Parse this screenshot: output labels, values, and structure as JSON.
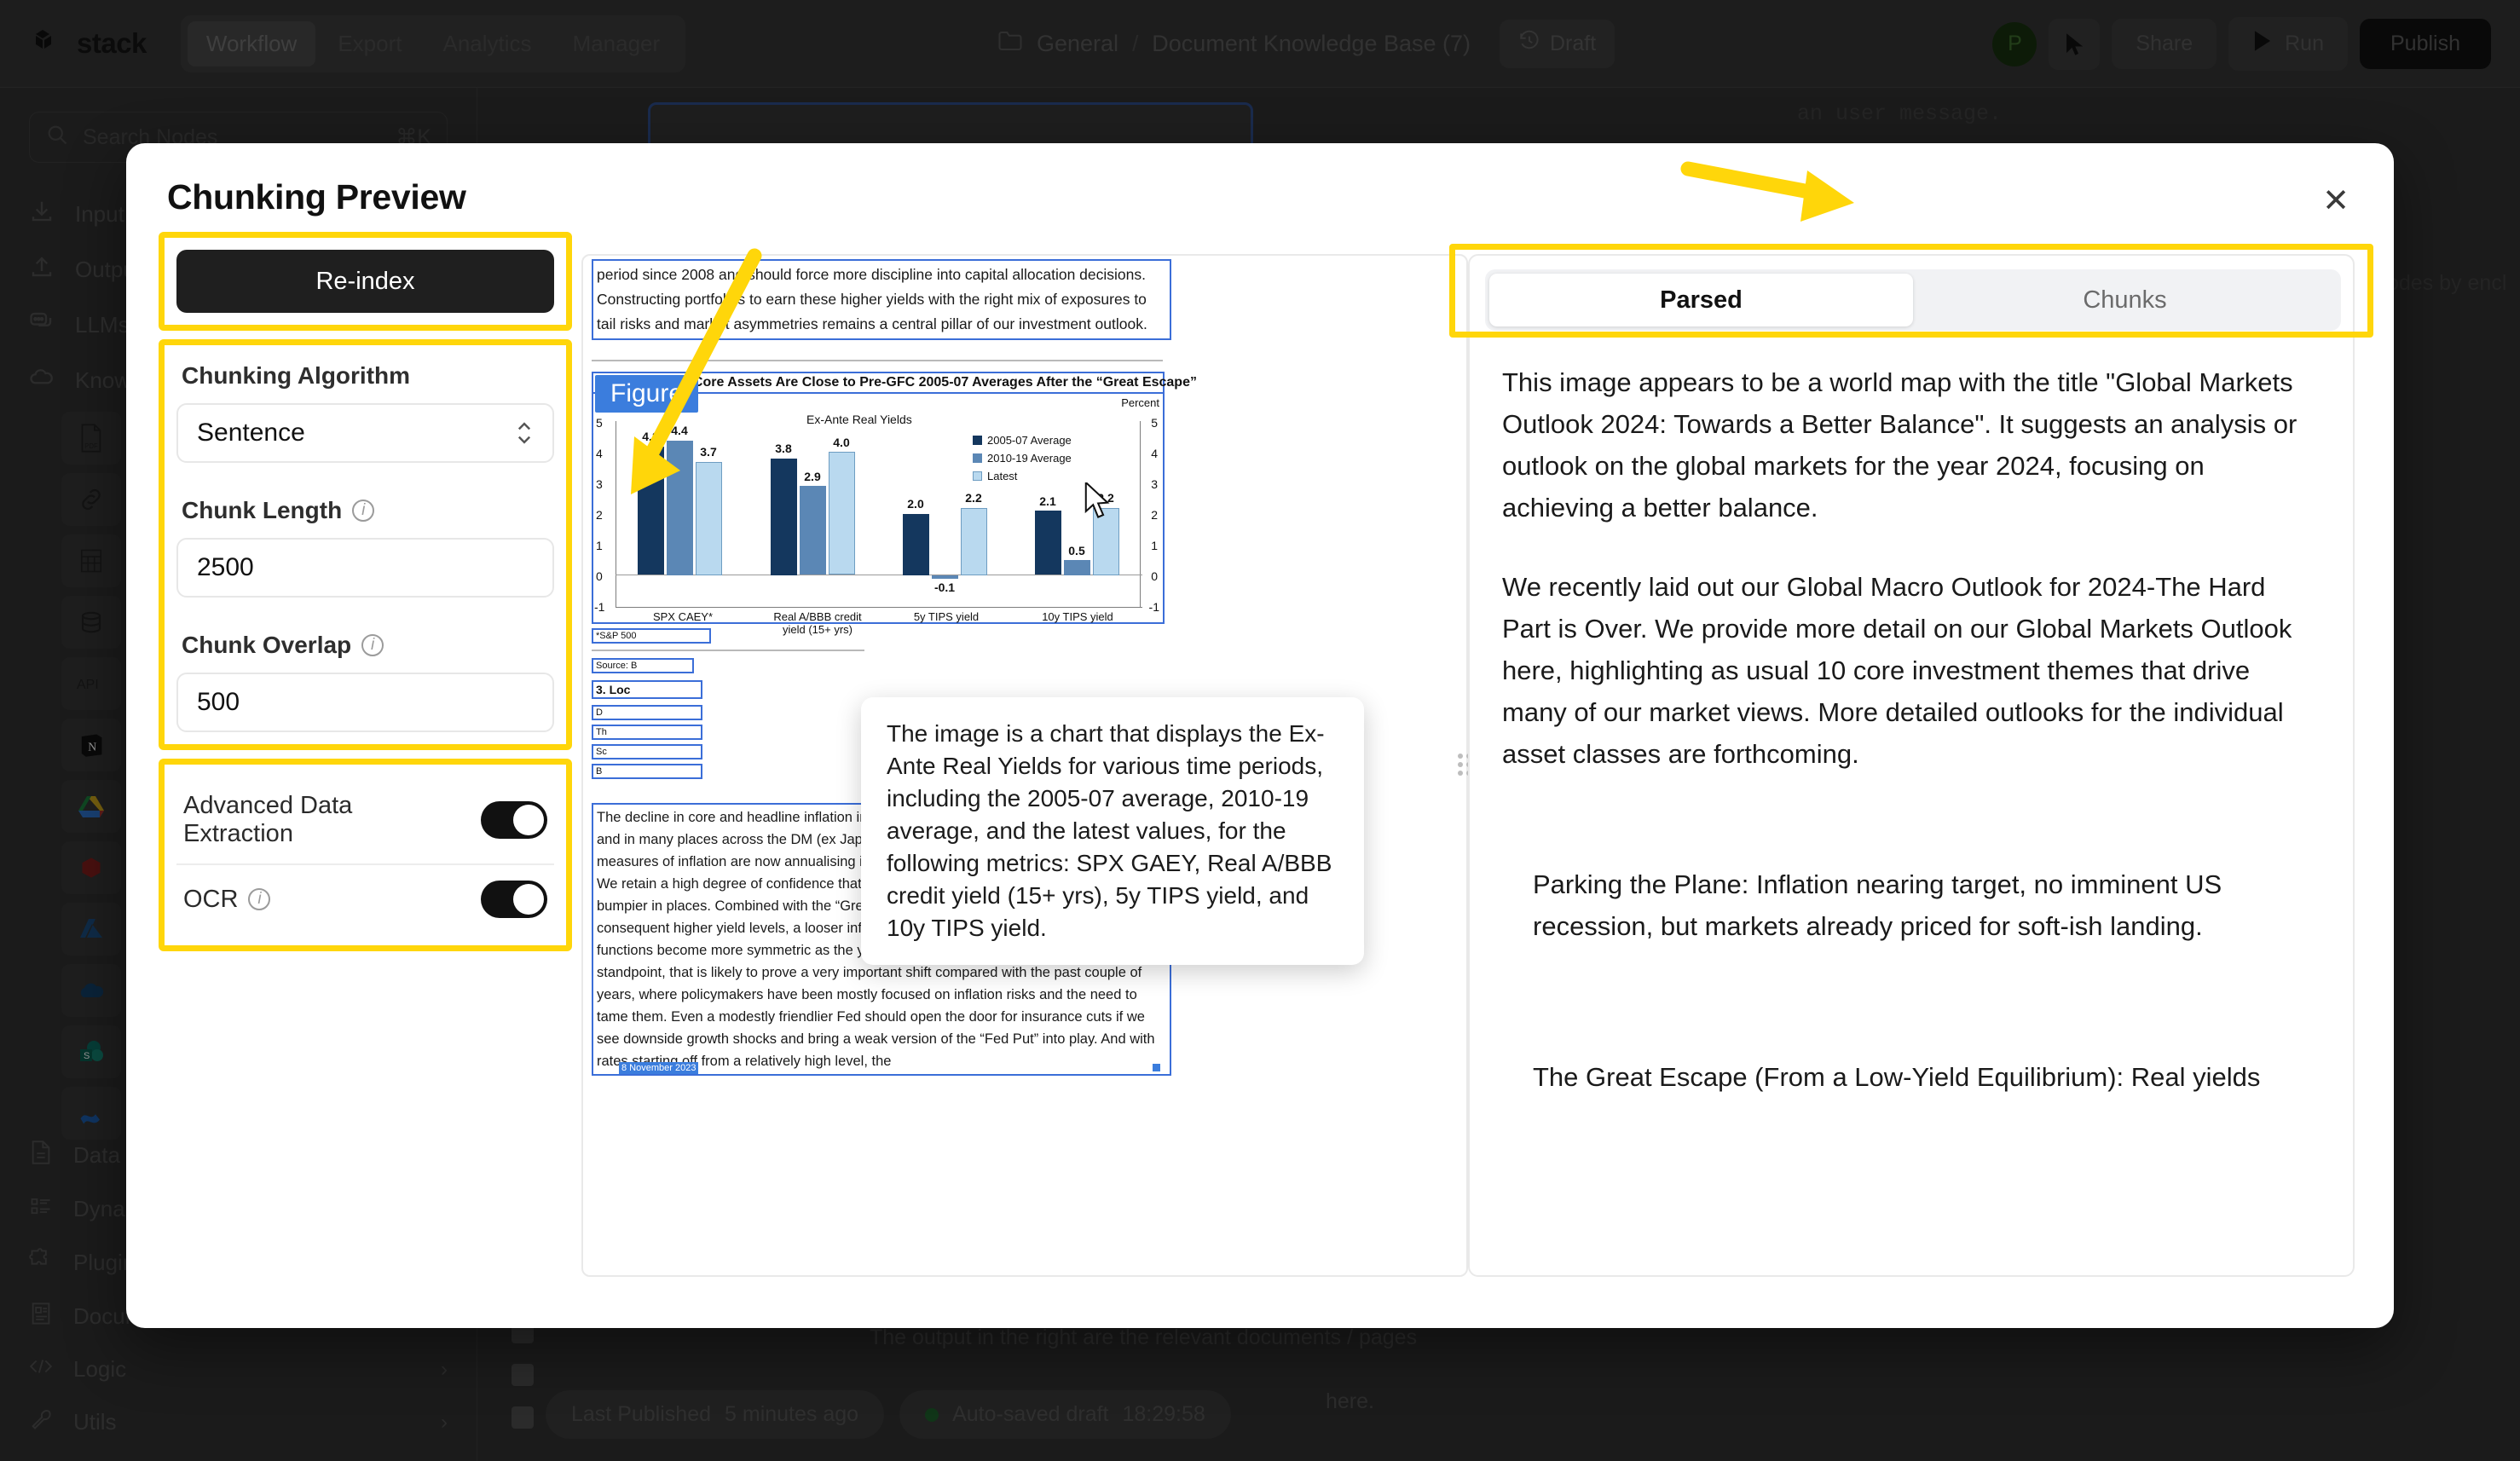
{
  "topbar": {
    "brand": "stack",
    "nav": [
      {
        "label": "Workflow",
        "active": true
      },
      {
        "label": "Export",
        "active": false
      },
      {
        "label": "Analytics",
        "active": false
      },
      {
        "label": "Manager",
        "active": false
      }
    ],
    "breadcrumb": {
      "folder": "General",
      "separator": "/",
      "document": "Document Knowledge Base (7)"
    },
    "draft_label": "Draft",
    "avatar_initial": "P",
    "share_label": "Share",
    "run_label": "Run",
    "publish_label": "Publish"
  },
  "sidebar": {
    "search_placeholder": "Search Nodes",
    "search_shortcut": "⌘K",
    "items": [
      {
        "label": "Input",
        "icon": "download-icon"
      },
      {
        "label": "Output",
        "icon": "upload-icon"
      },
      {
        "label": "LLMs",
        "icon": "chat-icon"
      },
      {
        "label": "Knowledge Base",
        "icon": "cloud-icon"
      }
    ],
    "node_icons": [
      "pdf-icon",
      "link-icon",
      "table-icon",
      "database-icon",
      "api-icon",
      "notion-icon",
      "google-drive-icon",
      "box-icon",
      "azure-icon",
      "onedrive-icon",
      "sharepoint-icon",
      "confluence-icon"
    ],
    "sections": [
      {
        "label": "Data Loaders",
        "icon": "document-icon"
      },
      {
        "label": "Dynamic Inputs",
        "icon": "list-icon"
      },
      {
        "label": "Plugins",
        "icon": "puzzle-icon"
      },
      {
        "label": "Document Readers",
        "icon": "reader-icon"
      },
      {
        "label": "Logic",
        "icon": "code-icon"
      },
      {
        "label": "Utils",
        "icon": "wrench-icon"
      }
    ]
  },
  "canvas": {
    "note_bullet": "The output in the right are the relevant documents / pages",
    "note_tail": "here.",
    "bg_code_line": "an user message.",
    "bg_right_text": "odes by encl",
    "last_published_label": "Last Published",
    "last_published_value": "5 minutes ago",
    "autosave_label": "Auto-saved draft",
    "autosave_time": "18:29:58"
  },
  "modal": {
    "title": "Chunking Preview",
    "close_icon": "close-icon",
    "reindex_label": "Re-index",
    "algorithm_label": "Chunking Algorithm",
    "algorithm_value": "Sentence",
    "chunk_length_label": "Chunk Length",
    "chunk_length_value": "2500",
    "chunk_overlap_label": "Chunk Overlap",
    "chunk_overlap_value": "500",
    "advanced_extraction_label": "Advanced Data Extraction",
    "advanced_extraction_on": true,
    "ocr_label": "OCR",
    "ocr_on": true,
    "highlight_color": "#FFD60A",
    "tabs": [
      {
        "label": "Parsed",
        "active": true
      },
      {
        "label": "Chunks",
        "active": false
      }
    ],
    "parsed_paragraphs": [
      "This image appears to be a world map with the title \"Global Markets Outlook 2024: Towards a Better Balance\". It suggests an analysis or outlook on the global markets for the year 2024, focusing on achieving a better balance.",
      "We recently laid out our Global Macro Outlook for 2024-The Hard Part is Over. We provide more detail on our Global Markets Outlook here, highlighting as usual 10 core investment themes that drive many of our market views. More detailed outlooks for the individual asset classes are forthcoming.",
      "Parking the Plane: Inflation nearing target, no imminent US recession, but markets already priced for soft-ish landing.",
      "The Great Escape (From a Low-Yield Equilibrium): Real yields"
    ]
  },
  "document_preview": {
    "top_paragraph": "period since 2008 and should force more discipline into capital allocation decisions. Constructing portfolios to earn these higher yields with the right mix of exposures to tail risks and market asymmetries remains a central pillar of our investment outlook.",
    "figure_badge": "Figure",
    "figure_title": "Real Yields on Core Assets Are Close to Pre-GFC 2005-07 Averages After the “Great Escape”",
    "footnote": "*S&P 500",
    "source_line": "Source: B",
    "section_heading": "3. Loc",
    "bullet_stubs": [
      "D",
      "Th",
      "Sc",
      "B"
    ],
    "tooltip_text": "The image is a chart that displays the Ex-Ante Real Yields for various time periods, including the 2005-07 average, 2010-19 average, and the latest values, for the following metrics: SPX GAEY, Real A/BBB credit yield (15+ yrs), 5y TIPS yield, and 10y TIPS yield.",
    "bottom_paragraph": "The decline in core and headline inflation in the second half of this year has been striking, and in many places across the DM (ex Japan) and EM (ex China) world, core and trimmed measures of inflation are now annualising in the vicinity of central banks’ inflation targets. We retain a high degree of confidence that disinflation will continue to progress, even if it is bumpier in places. Combined with the “Great Escape” (see Theme 2 above) and the consequent higher yield levels, a looser inflation constraint should mean that policy reaction functions become more symmetric as the year progresses. From an asset market standpoint, that is likely to prove a very important shift compared with the past couple of years, where policymakers have been mostly focused on inflation risks and the need to tame them. Even a modestly friendlier Fed should open the door for insurance cuts if we see downside growth shocks and bring a weak version of the “Fed Put” into play. And with rates starting off from a relatively high level, the",
    "page_footer": "8 November 2023"
  },
  "chart_data": {
    "type": "bar",
    "title": "Ex-Ante Real Yields",
    "categories": [
      "SPX CAEY*",
      "Real A/BBB credit yield (15+ yrs)",
      "5y TIPS yield",
      "10y TIPS yield"
    ],
    "series": [
      {
        "name": "2005-07 Average",
        "color": "#14375e",
        "values": [
          4.2,
          3.8,
          2.0,
          2.1
        ]
      },
      {
        "name": "2010-19 Average",
        "color": "#5b87b5",
        "values": [
          4.4,
          2.9,
          -0.1,
          0.5
        ]
      },
      {
        "name": "Latest",
        "color": "#b9d9ef",
        "values": [
          3.7,
          4.0,
          2.2,
          2.2
        ]
      }
    ],
    "ylabel": "Percent",
    "ylabel_right": "Percent",
    "ylim": [
      -1,
      5
    ],
    "yticks": [
      -1,
      0,
      1,
      2,
      3,
      4,
      5
    ],
    "legend_position": "top-right",
    "grid": false
  }
}
